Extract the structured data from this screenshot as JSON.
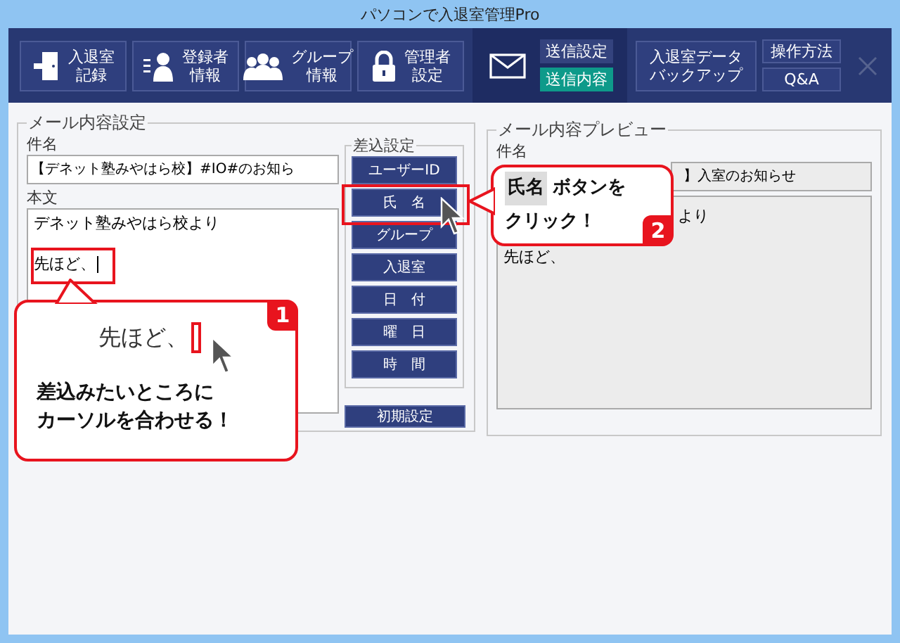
{
  "window": {
    "title": "パソコンで入退室管理Pro"
  },
  "toolbar": {
    "buttons": [
      {
        "kind": "door",
        "label": [
          "入退室",
          "記録"
        ]
      },
      {
        "kind": "person",
        "label": [
          "登録者",
          "情報"
        ]
      },
      {
        "kind": "group",
        "label": [
          "グループ",
          "情報"
        ]
      },
      {
        "kind": "lock",
        "label": [
          "管理者",
          "設定"
        ]
      }
    ],
    "mail_tabs": [
      {
        "label": "送信設定",
        "selected": false
      },
      {
        "label": "送信内容",
        "selected": true
      }
    ],
    "backup_button": [
      "入退室データ",
      "バックアップ"
    ],
    "help_buttons": [
      "操作方法",
      "Q&A"
    ]
  },
  "editor": {
    "title": "メール内容設定",
    "subject_label": "件名",
    "subject": "【デネット塾みやはら校】#IO#のお知ら",
    "body_label": "本文",
    "body_lines": [
      {
        "text": "デネット塾みやはら校より",
        "caret": false
      },
      {
        "text": "先ほど、",
        "caret": true
      }
    ]
  },
  "insert": {
    "title": "差込設定",
    "buttons": [
      "ユーザーID",
      "氏　名",
      "グループ",
      "入退室",
      "日　付",
      "曜　日",
      "時　間"
    ],
    "reset": "初期設定"
  },
  "preview": {
    "title": "メール内容プレビュー",
    "subject_label": "件名",
    "subject": "】入室のお知らせ",
    "body_lines": [
      "より",
      "先ほど、"
    ]
  },
  "callouts": [
    {
      "number": "1",
      "zoom_text": "先ほど、",
      "lines": [
        "差込みたいところに",
        "カーソルを合わせる！"
      ]
    },
    {
      "number": "2",
      "highlight": "氏名",
      "lines": [
        "ボタンを",
        "クリック！"
      ]
    }
  ]
}
